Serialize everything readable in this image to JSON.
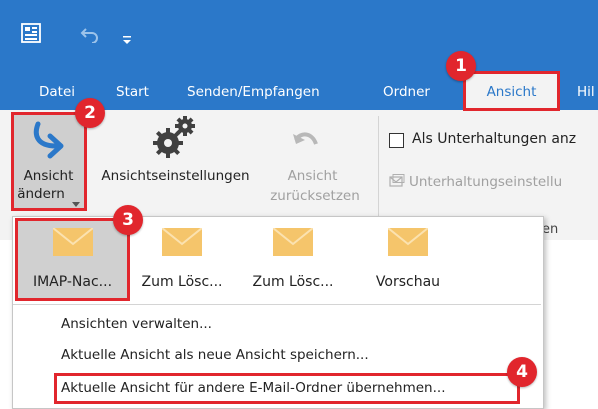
{
  "titlebar": {
    "color": "#2b78c9"
  },
  "tabs": [
    "Datei",
    "Start",
    "Senden/Empfangen",
    "Ordner",
    "Ansicht",
    "Hil"
  ],
  "ribbon": {
    "change_view": {
      "line1": "Ansicht",
      "line2": "ändern"
    },
    "view_settings": "Ansichtseinstellungen",
    "reset_view": {
      "line1": "Ansicht",
      "line2": "zurücksetzen"
    },
    "conversations_checkbox": "Als Unterhaltungen anz",
    "conversation_settings": "Unterhaltungseinstellu",
    "group_label_fragment": "en"
  },
  "gallery": [
    {
      "label": "IMAP-Nac..."
    },
    {
      "label": "Zum Lösc..."
    },
    {
      "label": "Zum Lösc..."
    },
    {
      "label": "Vorschau"
    }
  ],
  "menu": {
    "manage_views": "Ansichten verwalten...",
    "save_view": "Aktuelle Ansicht als neue Ansicht speichern...",
    "apply_view": "Aktuelle Ansicht für andere E-Mail-Ordner übernehmen..."
  },
  "badges": [
    "1",
    "2",
    "3",
    "4"
  ],
  "colors": {
    "accent": "#2b78c9",
    "highlight": "#e1262d",
    "envelope": "#f5c56b"
  }
}
